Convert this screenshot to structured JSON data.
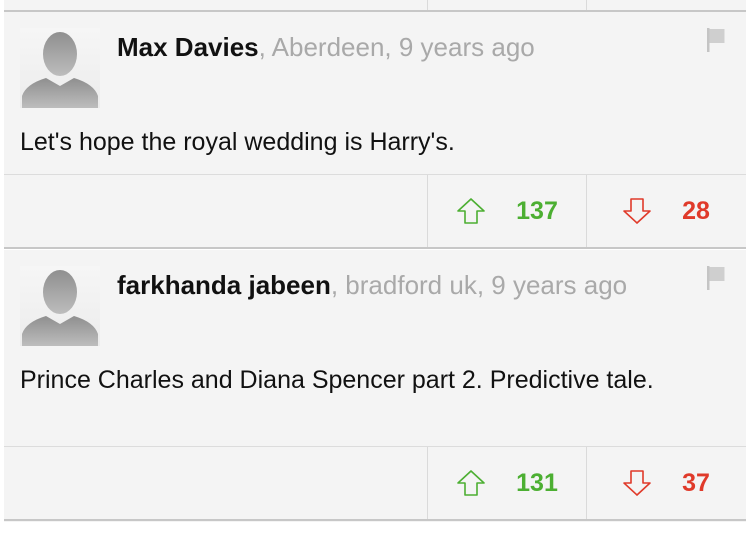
{
  "comments": [
    {
      "author": "Max Davies",
      "meta": ", Aberdeen, 9 years ago",
      "text": "Let's hope the royal wedding is Harry's.",
      "upvotes": "137",
      "downvotes": "28"
    },
    {
      "author": "farkhanda jabeen",
      "meta": ", bradford uk, 9 years ago",
      "text": "Prince Charles and Diana Spencer part 2. Predictive tale.",
      "upvotes": "131",
      "downvotes": "37"
    }
  ],
  "icons": {
    "avatar": "avatar-placeholder-icon",
    "flag": "flag-icon",
    "upvote": "arrow-up-icon",
    "downvote": "arrow-down-icon"
  },
  "colors": {
    "upvote": "#4caf32",
    "downvote": "#e03a2a",
    "meta": "#a9a9a9",
    "background": "#f4f4f4"
  }
}
